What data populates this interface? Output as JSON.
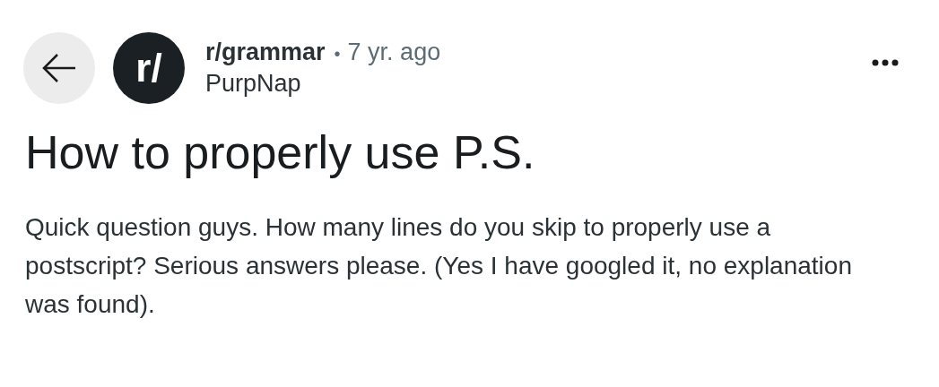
{
  "post": {
    "avatar_text": "r/",
    "subreddit": "r/grammar",
    "separator": "•",
    "age": "7 yr. ago",
    "author": "PurpNap",
    "title": "How to properly use P.S.",
    "body": "Quick question guys. How many lines do you skip to properly use a postscript? Serious answers please. (Yes I have googled it, no explanation was found)."
  }
}
